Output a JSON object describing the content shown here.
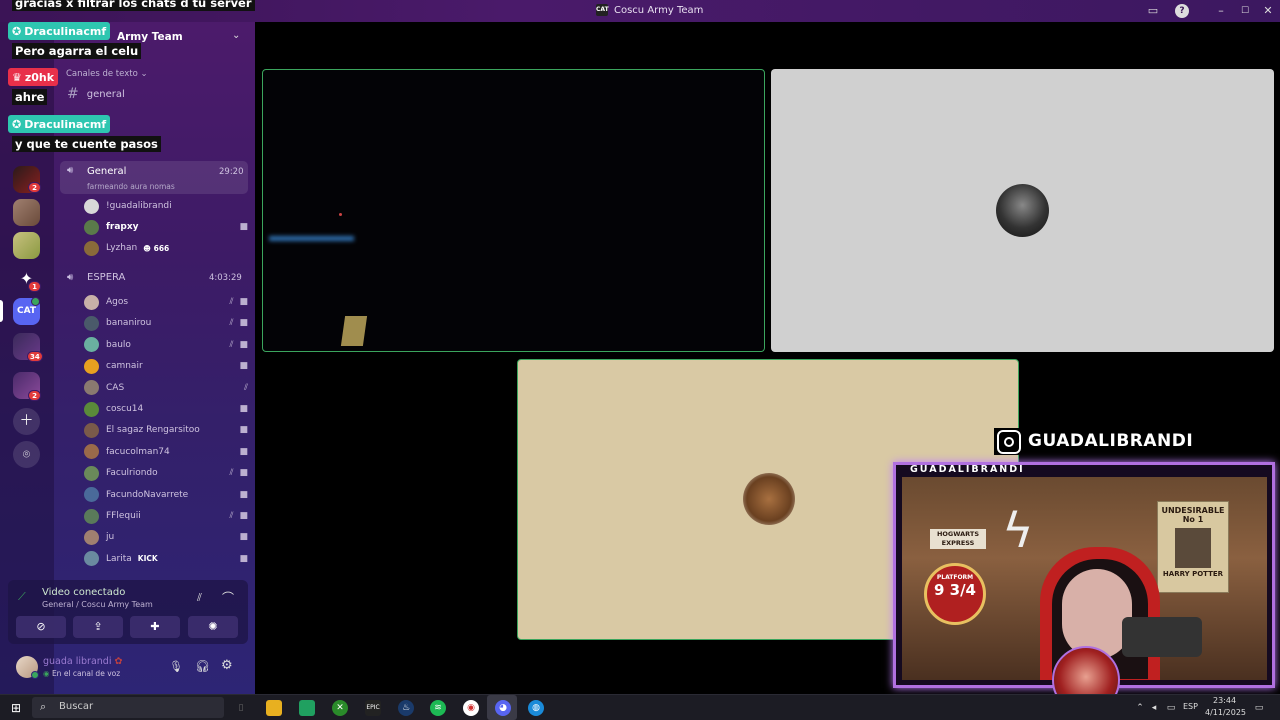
{
  "window": {
    "title": "Coscu Army Team",
    "logo_text": "CAT"
  },
  "sidebar": {
    "server_name": "Army Team",
    "category_text": "Canales de texto",
    "text_channel": "general",
    "servers": [
      {
        "name": "server-1",
        "badge": "2"
      },
      {
        "name": "server-2",
        "badge": ""
      },
      {
        "name": "server-3",
        "badge": ""
      },
      {
        "name": "server-4",
        "badge": "1"
      },
      {
        "name": "server-cat",
        "label": "CAT",
        "badge": ""
      },
      {
        "name": "folder-1",
        "badge": "34"
      },
      {
        "name": "folder-2",
        "badge": "2"
      }
    ],
    "voice_channels": [
      {
        "name": "General",
        "time": "29:20",
        "status": "farmeando aura nomas",
        "users": [
          {
            "name": "!guadalibrandi",
            "color": "#c9c9c9"
          },
          {
            "name": "frapxy",
            "color": "#5a7a4a"
          },
          {
            "name": "Lyzhan",
            "color": "#8a6a3a",
            "tag": "666"
          }
        ]
      },
      {
        "name": "ESPERA",
        "time": "4:03:29",
        "users": [
          {
            "name": "Agos",
            "color": "#c8b0a8"
          },
          {
            "name": "bananirou",
            "color": "#4a5a6a"
          },
          {
            "name": "baulo",
            "color": "#6ab0a0"
          },
          {
            "name": "camnair",
            "color": "#e8a020"
          },
          {
            "name": "CAS",
            "color": "#8a7a70"
          },
          {
            "name": "coscu14",
            "color": "#5a8a3a"
          },
          {
            "name": "El sagaz Rengarsitoo",
            "color": "#7a5a4a"
          },
          {
            "name": "facucolman74",
            "color": "#9a6a4a"
          },
          {
            "name": "Faculriondo",
            "color": "#6a8a5a"
          },
          {
            "name": "FacundoNavarrete",
            "color": "#4a6a9a"
          },
          {
            "name": "FFlequii",
            "color": "#5a7a5a"
          },
          {
            "name": "ju",
            "color": "#a08070"
          },
          {
            "name": "Larita",
            "color": "#6a8aa0",
            "tag": "KICK"
          }
        ]
      }
    ]
  },
  "chat_overlay": {
    "top_message": "gracias x filtrar los chats d tu server",
    "messages": [
      {
        "user": "Draculinacmf",
        "text": "Pero agarra el celu",
        "color": "#2ec6b0"
      },
      {
        "user": "z0hk",
        "text": "ahre",
        "color": "#e8304a"
      },
      {
        "user": "Draculinacmf",
        "text": "y que te cuente pasos",
        "color": "#2ec6b0"
      }
    ]
  },
  "voice_panel": {
    "status": "Video conectado",
    "location": "General / Coscu Army Team"
  },
  "user_panel": {
    "username": "guada librandi",
    "status": "En el canal de voz"
  },
  "streamer_overlay": {
    "instagram_handle": "GUADALIBRANDI",
    "frame_label": "GUADALIBRANDI",
    "poster_title": "UNDESIRABLE No 1",
    "poster_name": "HARRY POTTER",
    "sign_text": "HOGWARTS EXPRESS",
    "platform_text": "PLATFORM",
    "platform_number": "9 3/4"
  },
  "taskbar": {
    "search_placeholder": "Buscar",
    "language": "ESP",
    "time": "23:44",
    "date": "4/11/2025"
  }
}
